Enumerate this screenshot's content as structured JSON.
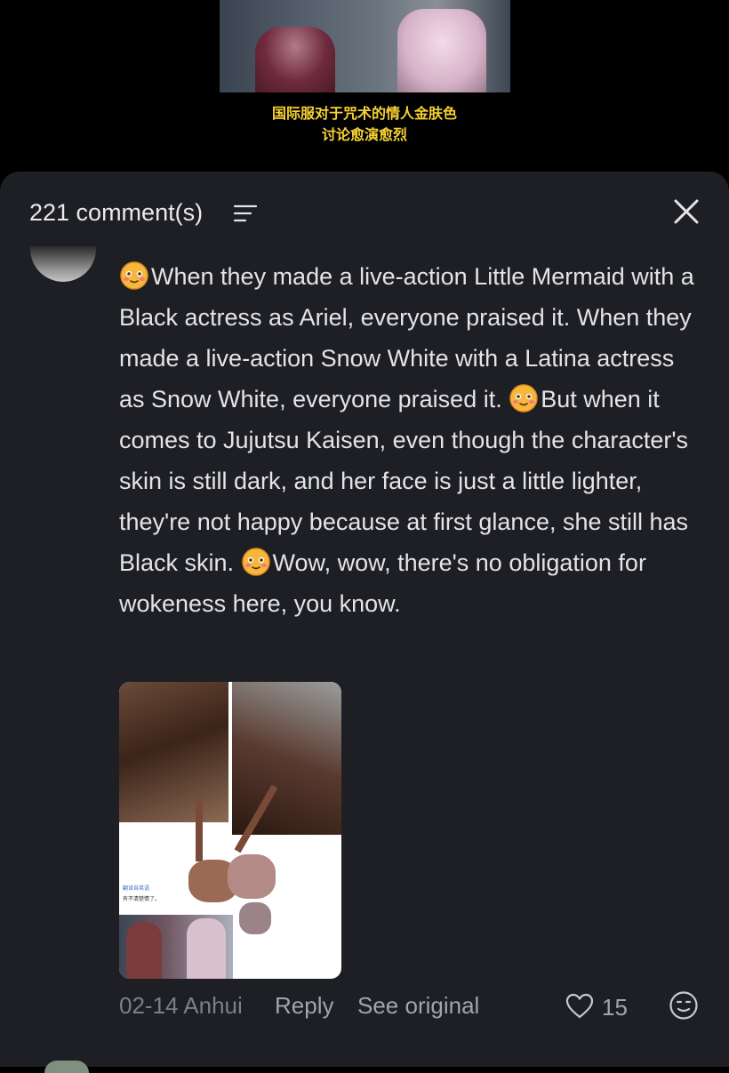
{
  "video": {
    "caption_line1": "国际服对于咒术的情人金肤色",
    "caption_line2": "讨论愈演愈烈"
  },
  "comments_sheet": {
    "count_label": "221 comment(s)",
    "filter_icon": "filter-lines-icon",
    "close_icon": "close-x-icon"
  },
  "comment": {
    "segments": [
      "When they made a live-action Little Mermaid with a Black actress as Ariel, everyone praised it. When they made a live-action Snow White with a Latina actress as Snow White, everyone praised it. ",
      "But when it comes to Jujutsu Kaisen, even though the character's skin is still dark, and her face is just a little lighter, they're not happy because at first glance, she still has Black skin. ",
      "Wow, wow, there's no obligation for wokeness here, you know."
    ],
    "emoji_icon": "blushing-smile-emoji-icon",
    "attachment_text_line1": "翻译自英语",
    "attachment_text_line2": "有不清楚情了。",
    "date_location": "02-14 Anhui",
    "reply_label": "Reply",
    "see_original_label": "See original",
    "like_count": "15",
    "like_icon": "heart-outline-icon",
    "react_icon": "smiley-face-icon"
  },
  "colors": {
    "sheet_bg": "#1e1f24",
    "caption_yellow": "#f7d233",
    "text_primary": "#e4e4e6",
    "text_muted": "#7e7f86",
    "text_action": "#a3a4ab"
  }
}
